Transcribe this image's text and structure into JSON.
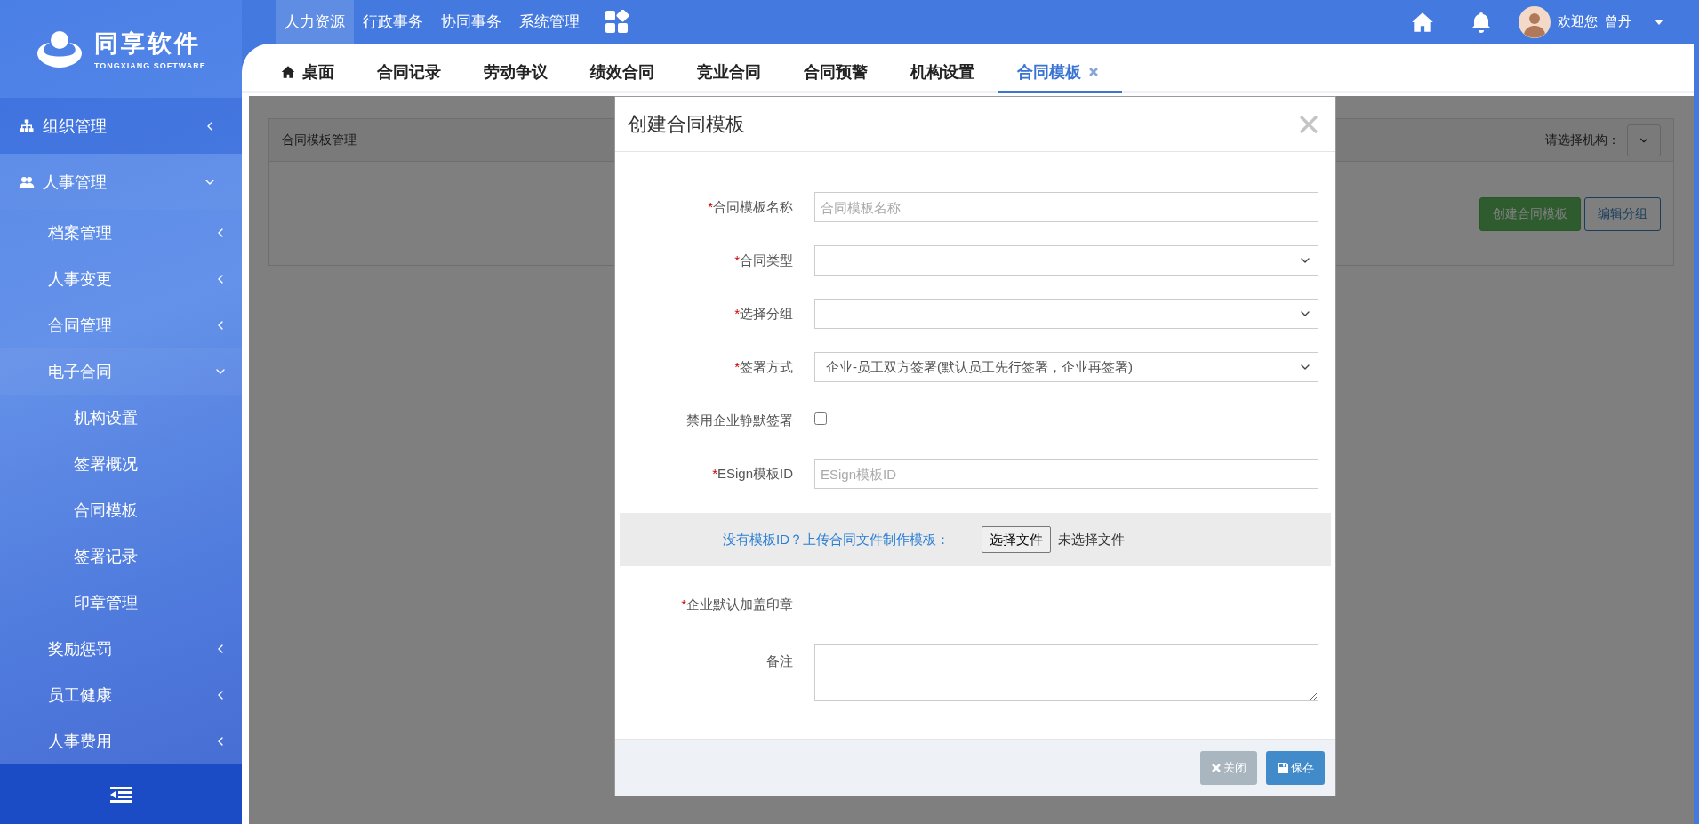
{
  "logo": {
    "name": "同享软件",
    "subtitle": "TONGXIANG SOFTWARE"
  },
  "top_nav": [
    {
      "label": "人力资源",
      "selected": true
    },
    {
      "label": "行政事务",
      "selected": false
    },
    {
      "label": "协同事务",
      "selected": false
    },
    {
      "label": "系统管理",
      "selected": false
    }
  ],
  "user": {
    "greeting": "欢迎您",
    "name": "曾丹"
  },
  "sidebar": {
    "items": [
      {
        "label": "组织管理",
        "expanded": false
      },
      {
        "label": "人事管理",
        "expanded": true,
        "children": [
          {
            "label": "档案管理",
            "expanded": false
          },
          {
            "label": "人事变更",
            "expanded": false
          },
          {
            "label": "合同管理",
            "expanded": false
          },
          {
            "label": "电子合同",
            "expanded": true,
            "children": [
              {
                "label": "机构设置"
              },
              {
                "label": "签署概况"
              },
              {
                "label": "合同模板"
              },
              {
                "label": "签署记录"
              },
              {
                "label": "印章管理"
              }
            ]
          },
          {
            "label": "奖励惩罚",
            "expanded": false
          },
          {
            "label": "员工健康",
            "expanded": false
          },
          {
            "label": "人事费用",
            "expanded": false
          }
        ]
      }
    ]
  },
  "tabs": [
    {
      "label": "桌面",
      "selected": false,
      "closable": false
    },
    {
      "label": "合同记录",
      "selected": false,
      "closable": false
    },
    {
      "label": "劳动争议",
      "selected": false,
      "closable": false
    },
    {
      "label": "绩效合同",
      "selected": false,
      "closable": false
    },
    {
      "label": "竞业合同",
      "selected": false,
      "closable": false
    },
    {
      "label": "合同预警",
      "selected": false,
      "closable": false
    },
    {
      "label": "机构设置",
      "selected": false,
      "closable": false
    },
    {
      "label": "合同模板",
      "selected": true,
      "closable": true
    }
  ],
  "panel": {
    "title": "合同模板管理",
    "org_label": "请选择机构：",
    "buttons": [
      {
        "label": "创建合同模板",
        "kind": "primary"
      },
      {
        "label": "编辑分组",
        "kind": "outline"
      }
    ]
  },
  "modal": {
    "title": "创建合同模板",
    "fields": [
      {
        "kind": "text",
        "marker": "*",
        "label": "合同模板名称",
        "placeholder": "合同模板名称"
      },
      {
        "kind": "select",
        "marker": "*",
        "label": "合同类型"
      },
      {
        "kind": "select",
        "marker": "*",
        "label": "选择分组"
      },
      {
        "kind": "select",
        "marker": "*",
        "label": "签署方式",
        "value": "企业-员工双方签署(默认员工先行签署，企业再签署)"
      },
      {
        "kind": "checkbox",
        "label": "禁用企业静默签署",
        "checked": false
      },
      {
        "kind": "text",
        "marker": "*",
        "label": "ESign模板ID",
        "placeholder": "ESign模板ID"
      },
      {
        "kind": "upload",
        "link": "没有模板ID？上传合同文件制作模板：",
        "button": "选择文件",
        "status": "未选择文件"
      },
      {
        "kind": "label",
        "marker": "*",
        "label": "企业默认加盖印章"
      },
      {
        "kind": "textarea",
        "label": "备注"
      }
    ],
    "buttons": [
      {
        "label": "关闭",
        "kind": "close"
      },
      {
        "label": "保存",
        "kind": "save"
      }
    ]
  }
}
